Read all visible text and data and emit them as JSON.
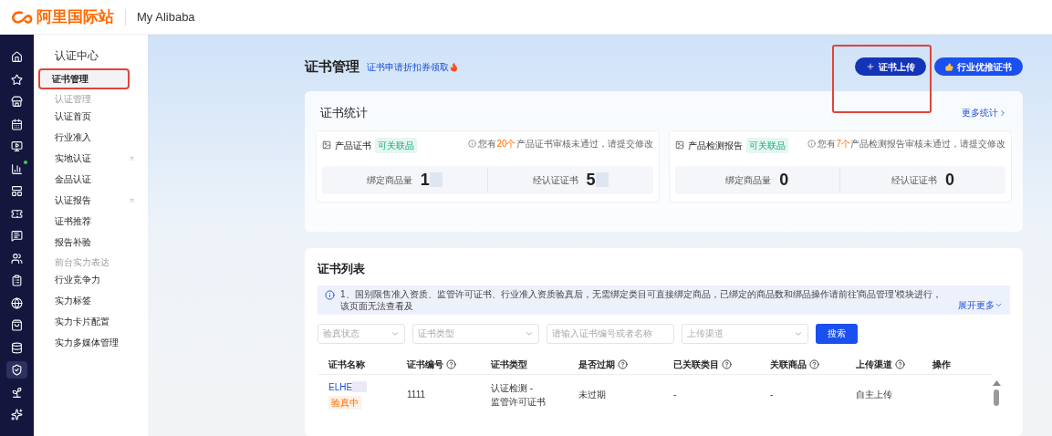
{
  "header": {
    "logo_text": "阿里国际站",
    "title": "My Alibaba"
  },
  "rail": [
    {
      "selected": false,
      "dot": false
    },
    {
      "selected": false,
      "dot": false
    },
    {
      "selected": false,
      "dot": false
    },
    {
      "selected": false,
      "dot": false
    },
    {
      "selected": false,
      "dot": false
    },
    {
      "selected": false,
      "dot": true
    },
    {
      "selected": false,
      "dot": false
    },
    {
      "selected": false,
      "dot": false
    },
    {
      "selected": false,
      "dot": false
    },
    {
      "selected": false,
      "dot": false
    },
    {
      "selected": false,
      "dot": false
    },
    {
      "selected": false,
      "dot": false
    },
    {
      "selected": false,
      "dot": false
    },
    {
      "selected": false,
      "dot": false
    },
    {
      "selected": true,
      "dot": false
    },
    {
      "selected": false,
      "dot": false
    },
    {
      "selected": false,
      "dot": false
    }
  ],
  "sidebar": {
    "title": "认证中心",
    "items": [
      {
        "kind": "item",
        "label": "证书管理",
        "selected": true,
        "external": false
      },
      {
        "kind": "group",
        "label": "认证管理"
      },
      {
        "kind": "item",
        "label": "认证首页",
        "selected": false,
        "external": false
      },
      {
        "kind": "item",
        "label": "行业准入",
        "selected": false,
        "external": false
      },
      {
        "kind": "item",
        "label": "实地认证",
        "selected": false,
        "external": true
      },
      {
        "kind": "item",
        "label": "金品认证",
        "selected": false,
        "external": false
      },
      {
        "kind": "item",
        "label": "认证报告",
        "selected": false,
        "external": true
      },
      {
        "kind": "item",
        "label": "证书推荐",
        "selected": false,
        "external": false
      },
      {
        "kind": "item",
        "label": "报告补验",
        "selected": false,
        "external": false
      },
      {
        "kind": "group",
        "label": "前台实力表达"
      },
      {
        "kind": "item",
        "label": "行业竞争力",
        "selected": false,
        "external": false
      },
      {
        "kind": "item",
        "label": "实力标签",
        "selected": false,
        "external": false
      },
      {
        "kind": "item",
        "label": "实力卡片配置",
        "selected": false,
        "external": false
      },
      {
        "kind": "item",
        "label": "实力多媒体管理",
        "selected": false,
        "external": false
      }
    ]
  },
  "page": {
    "title": "证书管理",
    "promo": "证书申请折扣券领取",
    "buttons": [
      {
        "kind": "upload",
        "label": "证书上传"
      },
      {
        "kind": "recommend",
        "label": "行业优推证书"
      }
    ],
    "stats": {
      "title": "证书统计",
      "more": "更多统计",
      "panels": [
        {
          "title": "产品证书",
          "tag": "可关联品",
          "notice_pre": "您有",
          "notice_count": "20个",
          "notice_post": "产品证书审核未通过，请提交修改",
          "metrics": [
            {
              "label": "绑定商品量",
              "value": "1",
              "blurred": true
            },
            {
              "label": "经认证证书",
              "value": "5",
              "blurred": true
            }
          ]
        },
        {
          "title": "产品检测报告",
          "tag": "可关联品",
          "notice_pre": "您有",
          "notice_count": "7个",
          "notice_post": "产品检测报告审核未通过，请提交修改",
          "metrics": [
            {
              "label": "绑定商品量",
              "value": "0",
              "blurred": false
            },
            {
              "label": "经认证证书",
              "value": "0",
              "blurred": false
            }
          ]
        }
      ]
    },
    "list": {
      "title": "证书列表",
      "notice": "1、国别限售准入资质、监管许可证书、行业准入资质验真后，无需绑定类目可直接绑定商品，已绑定的商品数和绑品操作请前往'商品管理'模块进行，该页面无法查看及",
      "expand": "展开更多",
      "filters": [
        {
          "kind": "select",
          "placeholder": "验真状态"
        },
        {
          "kind": "select",
          "placeholder": "证书类型"
        },
        {
          "kind": "input",
          "placeholder": "请输入证书编号或者名称"
        },
        {
          "kind": "select",
          "placeholder": "上传渠道"
        }
      ],
      "search": "搜索",
      "columns": [
        {
          "label": "证书名称",
          "help": false
        },
        {
          "label": "证书编号",
          "help": true
        },
        {
          "label": "证书类型",
          "help": false
        },
        {
          "label": "是否过期",
          "help": true
        },
        {
          "label": "已关联类目",
          "help": true
        },
        {
          "label": "关联商品",
          "help": true
        },
        {
          "label": "上传渠道",
          "help": true
        },
        {
          "label": "操作",
          "help": false
        }
      ],
      "rows": [
        {
          "name": "ELHE",
          "name_blurred": true,
          "status": "验真中",
          "number": "1111",
          "type": "认证检测 -\n监管许可证书",
          "expired": "未过期",
          "category": "-",
          "product": "-",
          "channel": "自主上传"
        }
      ]
    }
  }
}
